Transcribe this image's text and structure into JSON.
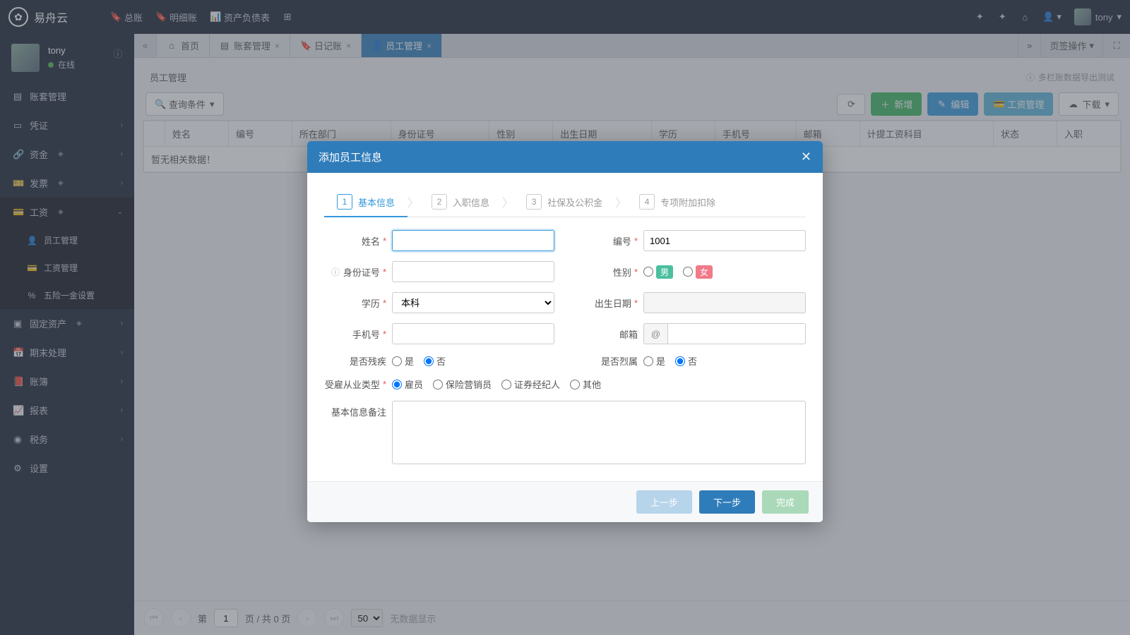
{
  "app": {
    "name": "易舟云"
  },
  "topnav": {
    "ledger": "总账",
    "detail": "明细账",
    "balance": "资产负债表"
  },
  "user": {
    "name": "tony",
    "status": "在线"
  },
  "sidebar": {
    "items": {
      "acct": "账套管理",
      "voucher": "凭证",
      "funds": "资金",
      "invoice": "发票",
      "salary": "工资",
      "fixed": "固定资产",
      "periodend": "期末处理",
      "book": "账簿",
      "report": "报表",
      "tax": "税务",
      "settings": "设置"
    },
    "salary_sub": {
      "employee": "员工管理",
      "wage": "工资管理",
      "insurance": "五险一金设置"
    }
  },
  "tabs": {
    "home": "首页",
    "acct": "账套管理",
    "journal": "日记账",
    "emp": "员工管理"
  },
  "tabbar": {
    "ops": "页签操作"
  },
  "page": {
    "title": "员工管理",
    "hint": "多栏账数据导出测试"
  },
  "toolbar": {
    "search": "查询条件",
    "refresh_title": "刷新",
    "add": "新增",
    "edit": "编辑",
    "wage": "工资管理",
    "download": "下载"
  },
  "table": {
    "cols": {
      "name": "姓名",
      "code": "编号",
      "dept": "所在部门",
      "idno": "身份证号",
      "gender": "性别",
      "birth": "出生日期",
      "edu": "学历",
      "phone": "手机号",
      "email": "邮箱",
      "subject": "计提工资科目",
      "status": "状态",
      "hire": "入职"
    },
    "empty": "暂无相关数据！"
  },
  "pager": {
    "page_label_pre": "第",
    "page": "1",
    "page_label_post": "页 / 共 0 页",
    "size": "50",
    "empty": "无数据显示"
  },
  "modal": {
    "title": "添加员工信息",
    "steps": {
      "s1": "基本信息",
      "s2": "入职信息",
      "s3": "社保及公积金",
      "s4": "专项附加扣除"
    },
    "labels": {
      "name": "姓名",
      "code": "编号",
      "idno": "身份证号",
      "gender": "性别",
      "edu": "学历",
      "birth": "出生日期",
      "phone": "手机号",
      "email": "邮箱",
      "disabled": "是否残疾",
      "martyr": "是否烈属",
      "emptype": "受雇从业类型",
      "notes": "基本信息备注"
    },
    "values": {
      "code": "1001",
      "edu": "本科"
    },
    "gender": {
      "m": "男",
      "f": "女"
    },
    "yesno": {
      "yes": "是",
      "no": "否"
    },
    "emptype": {
      "a": "雇员",
      "b": "保险营销员",
      "c": "证券经纪人",
      "d": "其他"
    },
    "email_at": "@",
    "buttons": {
      "prev": "上一步",
      "next": "下一步",
      "done": "完成"
    }
  }
}
